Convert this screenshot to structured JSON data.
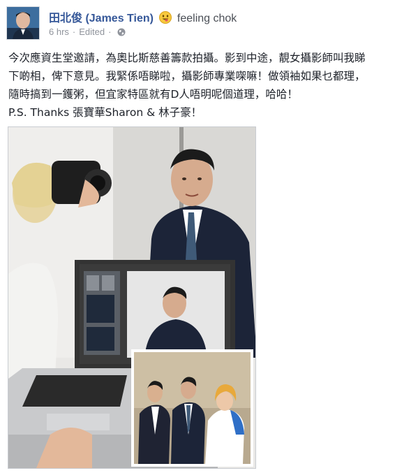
{
  "post": {
    "author": "田北俊 (James Tien)",
    "feeling": "feeling chok",
    "timestamp": "6 hrs",
    "separator": "·",
    "edited": "Edited",
    "body_lines": [
      "今次應資生堂邀請，為奧比斯慈善籌款拍攝。影到中途，靚女攝影師叫我睇",
      "下啲相，俾下意見。我緊係唔睇啦，攝影師專業㗎嘛！做領袖如果乜都理，",
      "隨時搞到一鑊粥，但宜家特區就有D人唔明呢個道理，哈哈！",
      "P.S. Thanks 張寶華Sharon & 林子豪！"
    ]
  },
  "icons": {
    "feeling": "grinning-tongue-emoji-icon",
    "privacy": "globe-icon"
  },
  "colors": {
    "author_link": "#365899",
    "meta_text": "#90949c",
    "body_text": "#1d2129"
  }
}
